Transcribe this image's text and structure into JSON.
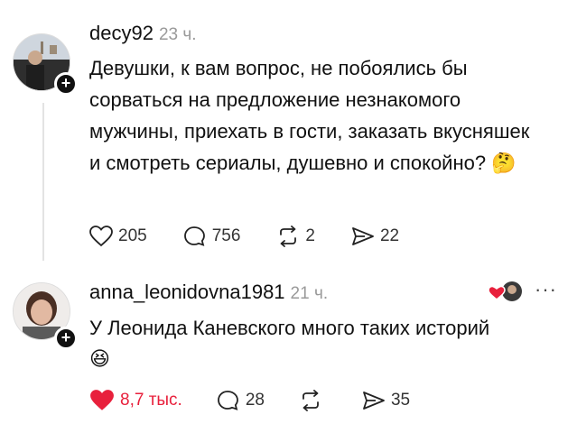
{
  "post": {
    "username": "decy92",
    "time": "23 ч.",
    "text": "Девушки, к вам вопрос, не побоялись бы сорваться на предложение незнакомого мужчины, приехать в гости, заказать вкусняшек и смотреть сериалы, душевно и спокойно?",
    "emoji": "🤔",
    "likes": "205",
    "comments": "756",
    "reposts": "2",
    "shares": "22"
  },
  "reply": {
    "username": "anna_leonidovna1981",
    "time": "21 ч.",
    "text": "У Леонида Каневского много таких историй",
    "emoji": "😆",
    "likes": "8,7 тыс.",
    "comments": "28",
    "shares": "35",
    "more": "···"
  },
  "icons": {
    "plus": "+"
  },
  "colors": {
    "liked_red": "#e8203c",
    "muted": "#9a9a9a"
  }
}
